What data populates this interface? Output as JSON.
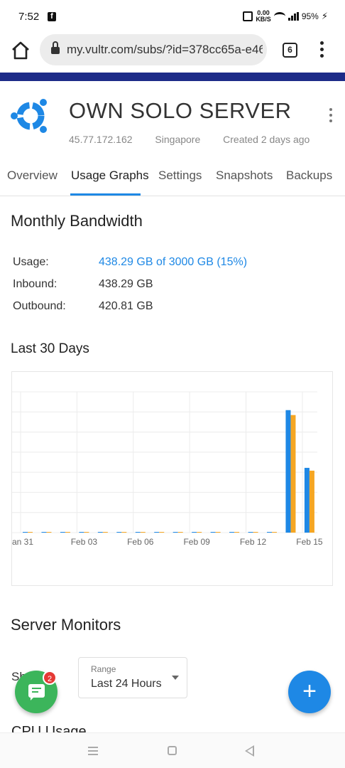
{
  "status_bar": {
    "time": "7:52",
    "notification_icon": "facebook-icon",
    "net_speed_value": "0.00",
    "net_speed_unit": "KB/S",
    "battery": "95%"
  },
  "browser": {
    "url": "my.vultr.com/subs/?id=378cc65a-e46",
    "tab_count": "6"
  },
  "server": {
    "name": "OWN SOLO SERVER",
    "ip": "45.77.172.162",
    "location": "Singapore",
    "created": "Created 2 days ago"
  },
  "tabs": [
    {
      "label": "Overview"
    },
    {
      "label": "Usage Graphs",
      "active": true
    },
    {
      "label": "Settings"
    },
    {
      "label": "Snapshots"
    },
    {
      "label": "Backups"
    }
  ],
  "bandwidth": {
    "title": "Monthly Bandwidth",
    "rows": [
      {
        "label": "Usage:",
        "value": "438.29 GB of 3000 GB (15%)"
      },
      {
        "label": "Inbound:",
        "value": "438.29 GB"
      },
      {
        "label": "Outbound:",
        "value": "420.81 GB"
      }
    ]
  },
  "chart_title": "Last 30 Days",
  "chart_data": {
    "type": "bar",
    "title": "",
    "tick_labels": [
      "an 31",
      "Feb 03",
      "Feb 06",
      "Feb 09",
      "Feb 12",
      "Feb 15"
    ],
    "categories": [
      "Jan 31",
      "Feb 01",
      "Feb 02",
      "Feb 03",
      "Feb 04",
      "Feb 05",
      "Feb 06",
      "Feb 07",
      "Feb 08",
      "Feb 09",
      "Feb 10",
      "Feb 11",
      "Feb 12",
      "Feb 13",
      "Feb 14",
      "Feb 15"
    ],
    "series": [
      {
        "color": "#1e88e5",
        "values": [
          0,
          0,
          0,
          0,
          0,
          0,
          0,
          0,
          0,
          0,
          0,
          0,
          0,
          0,
          174,
          92
        ]
      },
      {
        "color": "#f5a623",
        "values": [
          0,
          0,
          0,
          0,
          0,
          0,
          0,
          0,
          0,
          0,
          0,
          0,
          0,
          0,
          167,
          88
        ]
      }
    ],
    "ylim": [
      0,
      200
    ],
    "grid": true
  },
  "monitors": {
    "title": "Server Monitors",
    "partial_label": "Sh",
    "range_label": "Range",
    "range_value": "Last 24 Hours",
    "next_section": "CPU Usage"
  },
  "chat": {
    "badge_count": "2"
  },
  "fab_add": "+",
  "colors": {
    "accent": "#1e88e5",
    "brand_bar": "#1d2b88",
    "chat_green": "#3cb55b",
    "badge_red": "#e53935"
  }
}
